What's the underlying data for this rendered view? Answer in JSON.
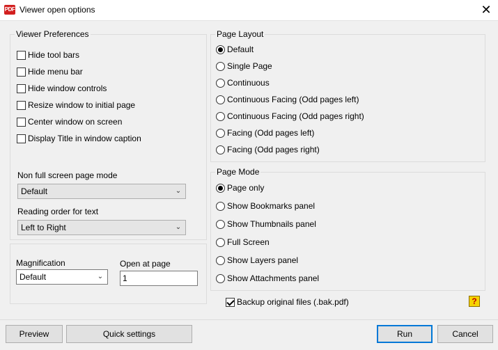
{
  "window": {
    "title": "Viewer open options",
    "app_icon_text": "PDF"
  },
  "viewer_prefs": {
    "legend": "Viewer Preferences",
    "options": [
      {
        "label": "Hide tool bars",
        "checked": false
      },
      {
        "label": "Hide menu bar",
        "checked": false
      },
      {
        "label": "Hide window controls",
        "checked": false
      },
      {
        "label": "Resize window to initial page",
        "checked": false
      },
      {
        "label": "Center window on screen",
        "checked": false
      },
      {
        "label": "Display Title in window caption",
        "checked": false
      }
    ],
    "nonfull_label": "Non full screen page mode",
    "nonfull_value": "Default",
    "reading_label": "Reading order for text",
    "reading_value": "Left to Right"
  },
  "magnification": {
    "label": "Magnification",
    "value": "Default"
  },
  "open_at_page": {
    "label": "Open at page",
    "value": "1"
  },
  "page_layout": {
    "legend": "Page Layout",
    "options": [
      {
        "label": "Default",
        "checked": true
      },
      {
        "label": "Single Page",
        "checked": false
      },
      {
        "label": "Continuous",
        "checked": false
      },
      {
        "label": "Continuous Facing (Odd pages left)",
        "checked": false
      },
      {
        "label": "Continuous Facing (Odd pages right)",
        "checked": false
      },
      {
        "label": "Facing (Odd pages left)",
        "checked": false
      },
      {
        "label": "Facing (Odd pages right)",
        "checked": false
      }
    ]
  },
  "page_mode": {
    "legend": "Page Mode",
    "options": [
      {
        "label": "Page only",
        "checked": true
      },
      {
        "label": "Show Bookmarks panel",
        "checked": false
      },
      {
        "label": "Show Thumbnails panel",
        "checked": false
      },
      {
        "label": "Full Screen",
        "checked": false
      },
      {
        "label": "Show Layers panel",
        "checked": false
      },
      {
        "label": "Show Attachments panel",
        "checked": false
      }
    ]
  },
  "backup": {
    "label": "Backup original files (.bak.pdf)",
    "checked": true
  },
  "buttons": {
    "preview": "Preview",
    "quick_settings": "Quick settings",
    "run": "Run",
    "cancel": "Cancel"
  }
}
